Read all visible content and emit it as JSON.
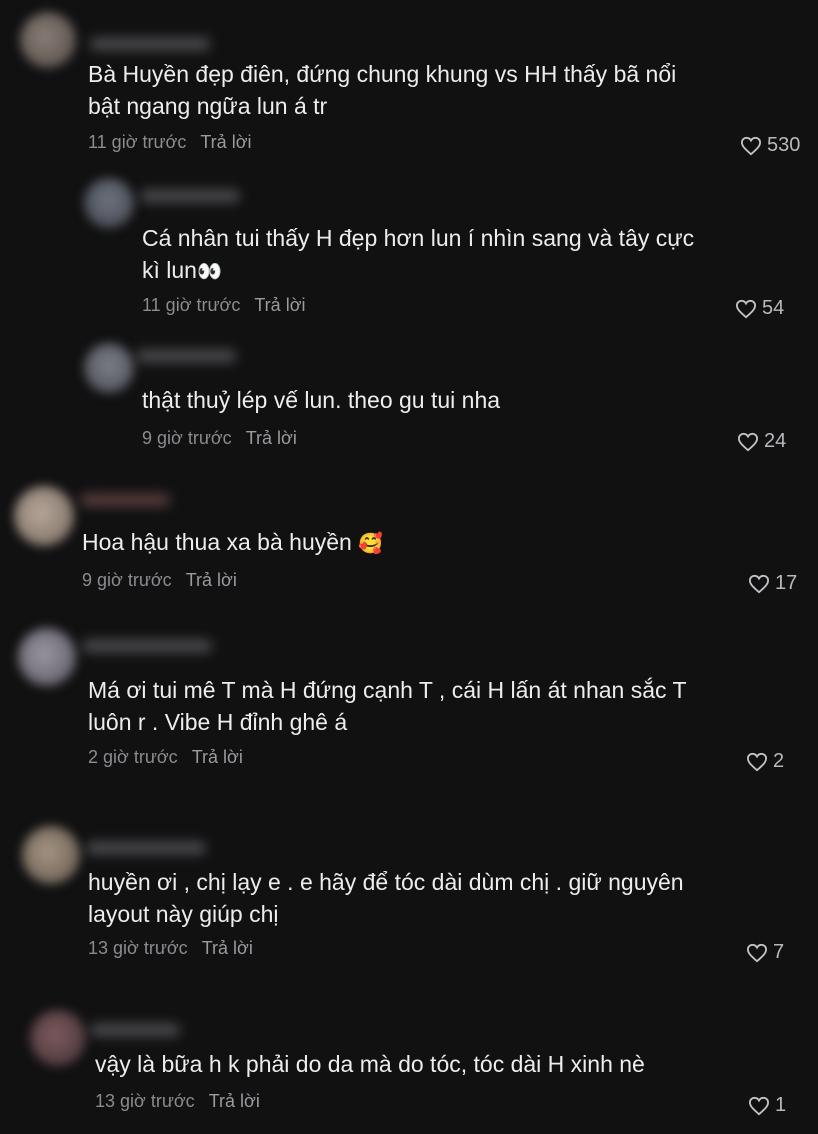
{
  "comments": [
    {
      "text": "Bà Huyền đẹp điên, đứng chung khung vs HH thấy bã nổi bật ngang ngữa lun á tr",
      "time": "11 giờ trước",
      "reply": "Trả lời",
      "likes": "530"
    },
    {
      "text": "Cá nhân tui thấy H đẹp hơn lun í nhìn sang và tây cực kì lun",
      "emoji": "👀",
      "time": "11 giờ trước",
      "reply": "Trả lời",
      "likes": "54"
    },
    {
      "text": "thật thuỷ lép vế lun. theo gu tui nha",
      "time": "9 giờ trước",
      "reply": "Trả lời",
      "likes": "24"
    },
    {
      "text": "Hoa hậu thua xa bà huyền ",
      "emoji": "🥰",
      "time": "9 giờ trước",
      "reply": "Trả lời",
      "likes": "17"
    },
    {
      "text": "Má ơi tui mê T mà H đứng cạnh T , cái H lấn át nhan sắc T luôn r . Vibe H đỉnh ghê á",
      "time": "2 giờ trước",
      "reply": "Trả lời",
      "likes": "2"
    },
    {
      "text": "huyền ơi , chị lạy e . e hãy để tóc dài dùm chị . giữ nguyên layout này giúp chị",
      "time": "13 giờ trước",
      "reply": "Trả lời",
      "likes": "7"
    },
    {
      "text": "vậy là bữa h k phải do da mà do tóc, tóc dài H xinh nè",
      "time": "13 giờ trước",
      "reply": "Trả lời",
      "likes": "1"
    }
  ],
  "colors": {
    "background": "#111112",
    "text": "#ededed",
    "meta": "#8b8b90"
  },
  "icons": {
    "like": "heart-outline-icon"
  }
}
